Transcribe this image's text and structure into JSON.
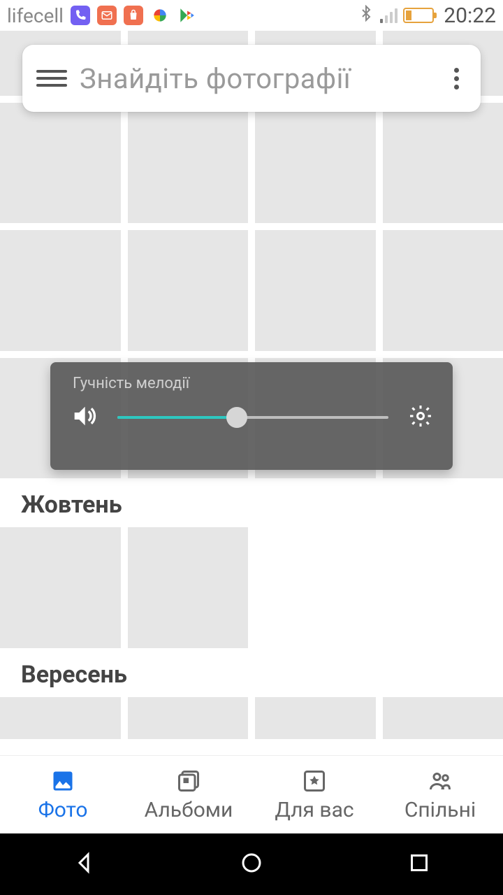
{
  "status": {
    "carrier": "lifecell",
    "time": "20:22"
  },
  "search": {
    "placeholder": "Знайдіть фотографії"
  },
  "volume": {
    "label": "Гучність мелодії",
    "percent": 44
  },
  "sections": {
    "october": "Жовтень",
    "september": "Вересень"
  },
  "tabs": {
    "photos": "Фото",
    "albums": "Альбоми",
    "foryou": "Для вас",
    "shared": "Спільні"
  }
}
